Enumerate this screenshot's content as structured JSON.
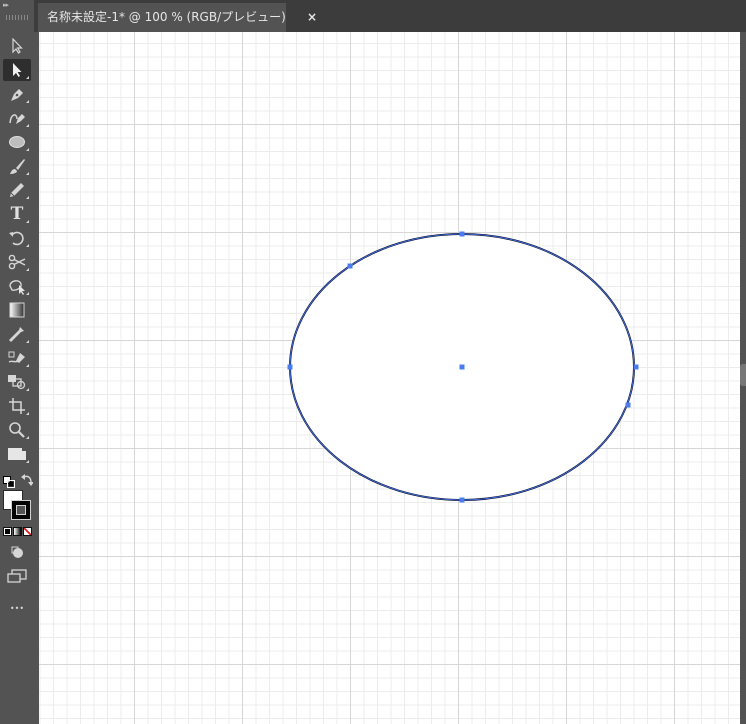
{
  "tab": {
    "title": "名称未設定-1* @ 100 % (RGB/プレビュー)",
    "close_label": "×"
  },
  "toolbar": {
    "collapse_label": "▸▸",
    "tools": [
      {
        "name": "selection-tool",
        "icon": "arrow-outline-icon"
      },
      {
        "name": "direct-selection-tool",
        "icon": "arrow-filled-icon",
        "active": true
      },
      {
        "name": "pen-tool",
        "icon": "pen-icon"
      },
      {
        "name": "curvature-tool",
        "icon": "curvature-pen-icon"
      },
      {
        "name": "ellipse-tool",
        "icon": "ellipse-icon"
      },
      {
        "name": "paintbrush-tool",
        "icon": "brush-icon"
      },
      {
        "name": "pencil-tool",
        "icon": "pencil-icon"
      },
      {
        "name": "type-tool",
        "icon": "type-icon",
        "label": "T"
      },
      {
        "name": "rotate-tool",
        "icon": "rotate-icon"
      },
      {
        "name": "scissors-tool",
        "icon": "scissors-icon"
      },
      {
        "name": "puppet-warp-tool",
        "icon": "warp-icon"
      },
      {
        "name": "gradient-tool",
        "icon": "gradient-icon"
      },
      {
        "name": "eyedropper-tool",
        "icon": "eyedropper-icon"
      },
      {
        "name": "blend-tool",
        "icon": "blend-icon"
      },
      {
        "name": "shape-builder-tool",
        "icon": "shape-builder-icon"
      },
      {
        "name": "artboard-tool",
        "icon": "artboard-icon"
      },
      {
        "name": "zoom-tool",
        "icon": "zoom-icon"
      },
      {
        "name": "hand-tool",
        "icon": "hand-icon"
      }
    ],
    "more_label": "•••"
  },
  "colors": {
    "accent": "#4a7cf0",
    "path_stroke": "#0d1133",
    "toolbar_bg": "#535353",
    "canvas_bg": "#ffffff",
    "fill": "#ffffff",
    "stroke": "#000000"
  }
}
